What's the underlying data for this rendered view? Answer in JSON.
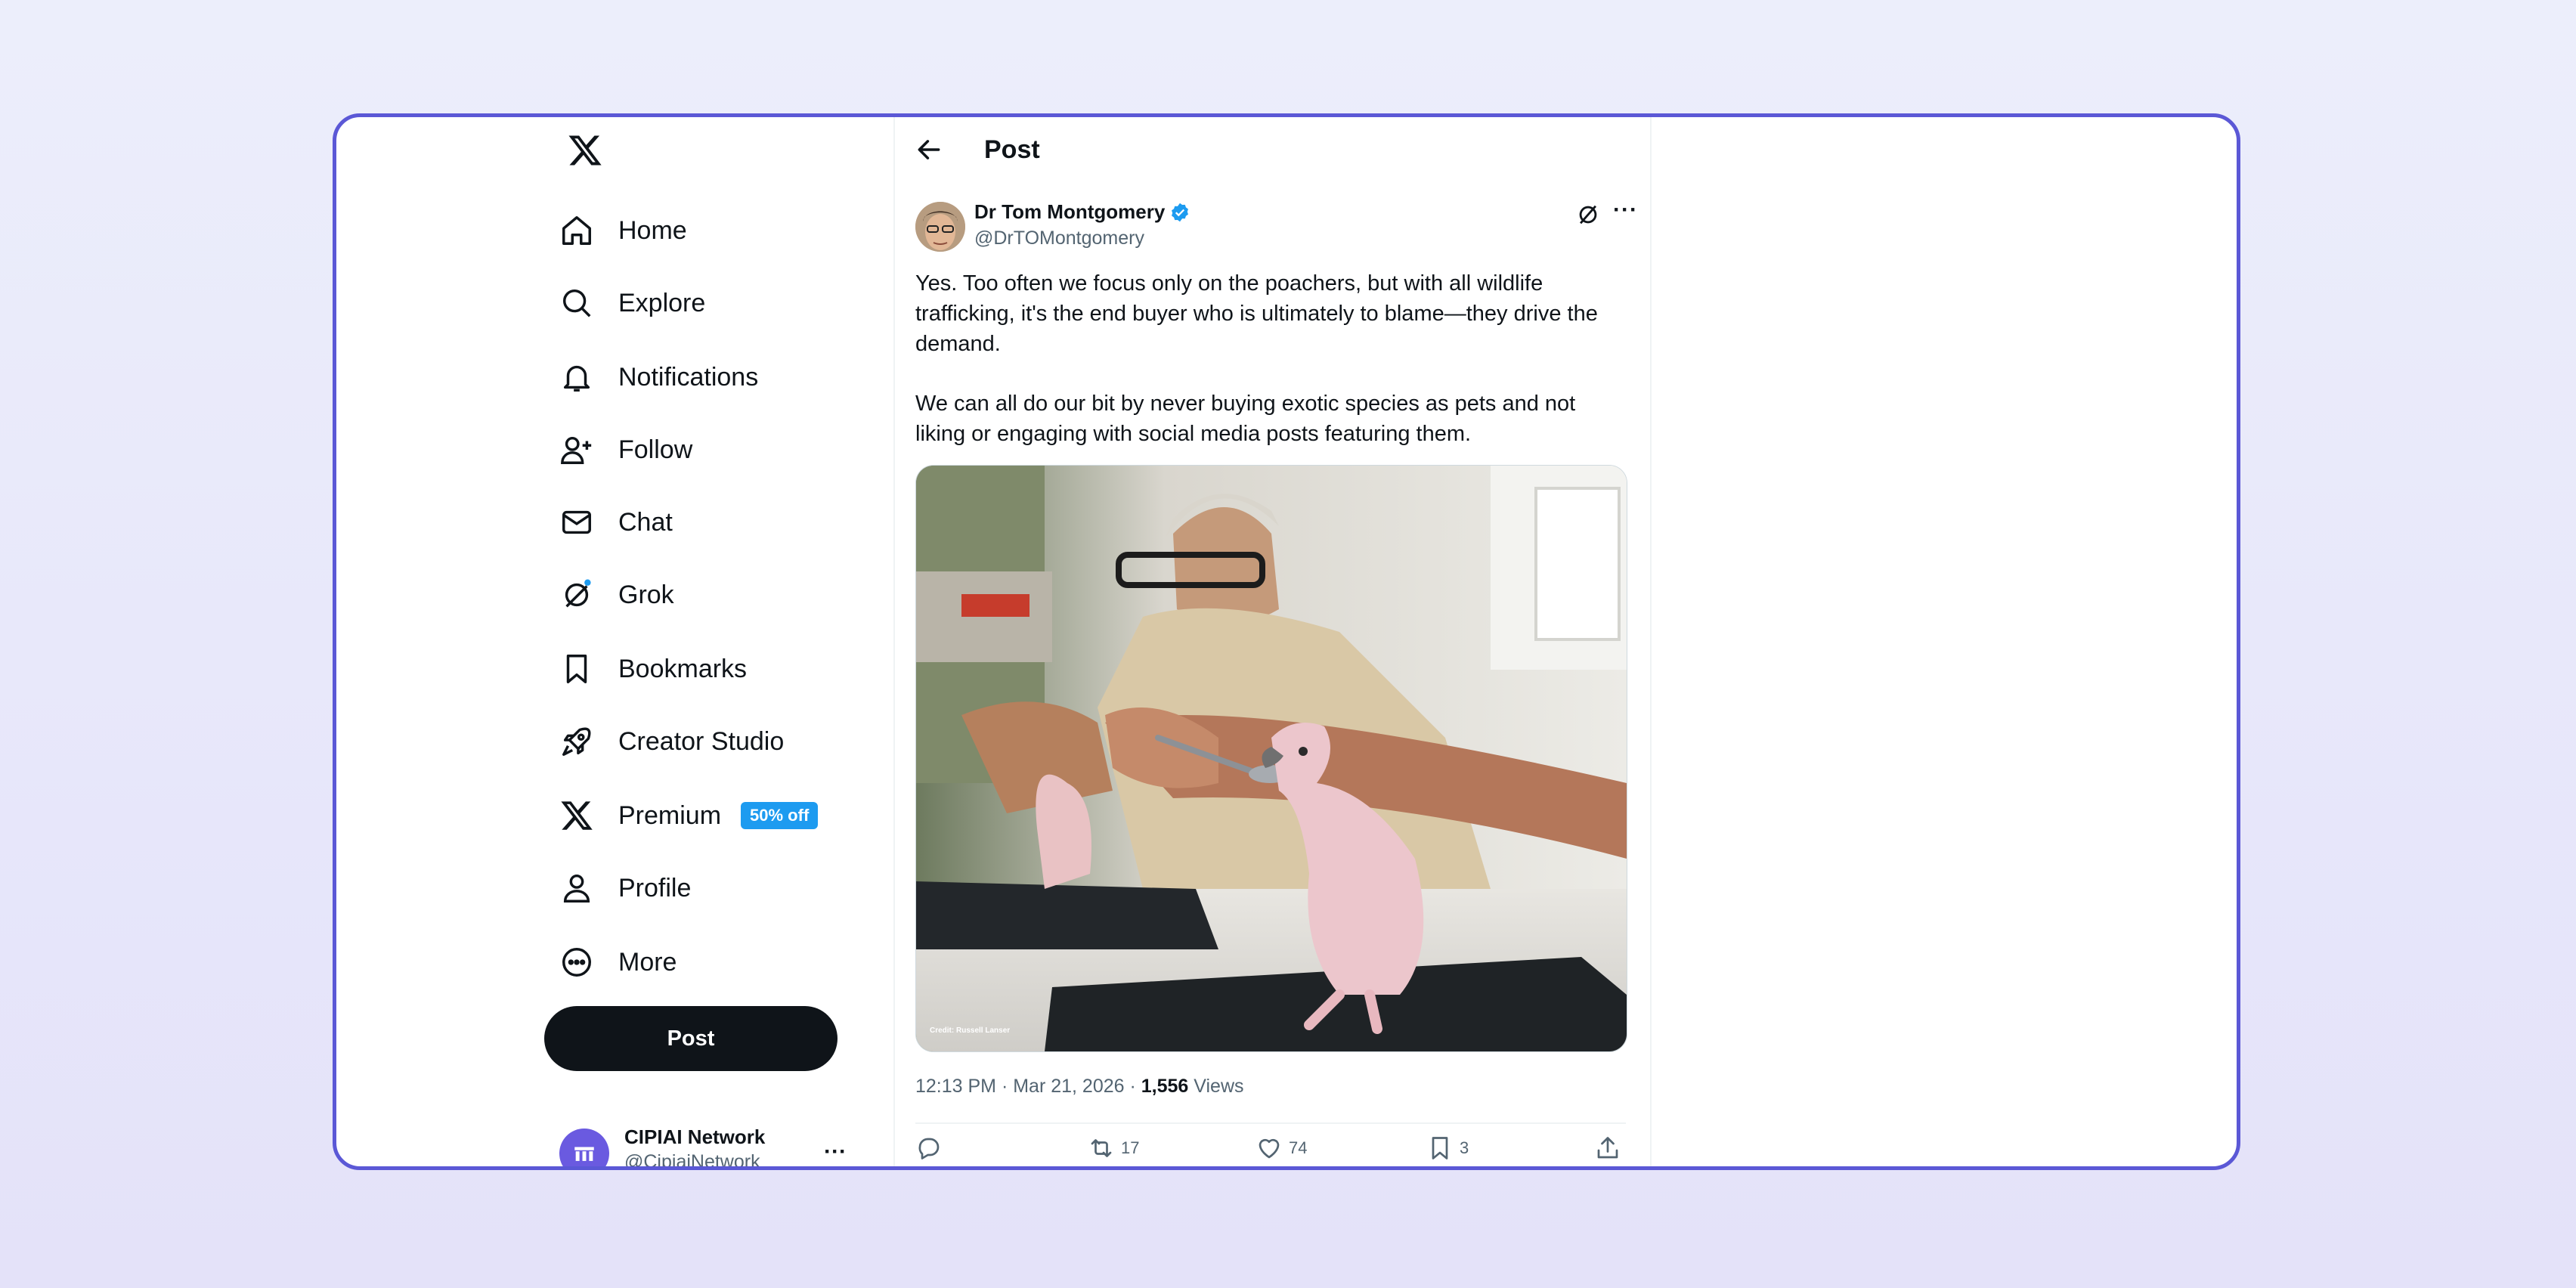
{
  "sidebar": {
    "items": [
      {
        "label": "Home",
        "icon": "home-icon"
      },
      {
        "label": "Explore",
        "icon": "search-icon"
      },
      {
        "label": "Notifications",
        "icon": "bell-icon"
      },
      {
        "label": "Follow",
        "icon": "add-person-icon"
      },
      {
        "label": "Chat",
        "icon": "envelope-icon"
      },
      {
        "label": "Grok",
        "icon": "grok-icon"
      },
      {
        "label": "Bookmarks",
        "icon": "bookmark-icon"
      },
      {
        "label": "Creator Studio",
        "icon": "rocket-icon"
      },
      {
        "label": "Premium",
        "icon": "x-logo-icon",
        "badge": "50% off"
      },
      {
        "label": "Profile",
        "icon": "person-icon"
      },
      {
        "label": "More",
        "icon": "more-circle-icon"
      }
    ],
    "post_button": "Post",
    "account": {
      "name": "CIPIAI Network",
      "handle": "@CipiaiNetwork"
    }
  },
  "header": {
    "title": "Post"
  },
  "tweet": {
    "author_name": "Dr Tom Montgomery",
    "author_handle": "@DrTOMontgomery",
    "paragraph_1": "Yes. Too often we focus only on the poachers, but with all wildlife trafficking, it's the end buyer who is ultimately to blame—they drive the demand.",
    "paragraph_2": "We can all do our bit by never buying exotic species as pets and not liking or engaging with social media posts featuring them.",
    "image_credit": "Credit: Russell Lanser",
    "time": "12:13 PM · Mar 21, 2026 · ",
    "views": "1,556",
    "views_label": " Views",
    "retweets": "17",
    "likes": "74",
    "bookmarks": "3"
  },
  "colors": {
    "accent": "#1d9bf0",
    "frame_border": "#5b58d6",
    "text": "#0f1419",
    "muted": "#536471"
  }
}
